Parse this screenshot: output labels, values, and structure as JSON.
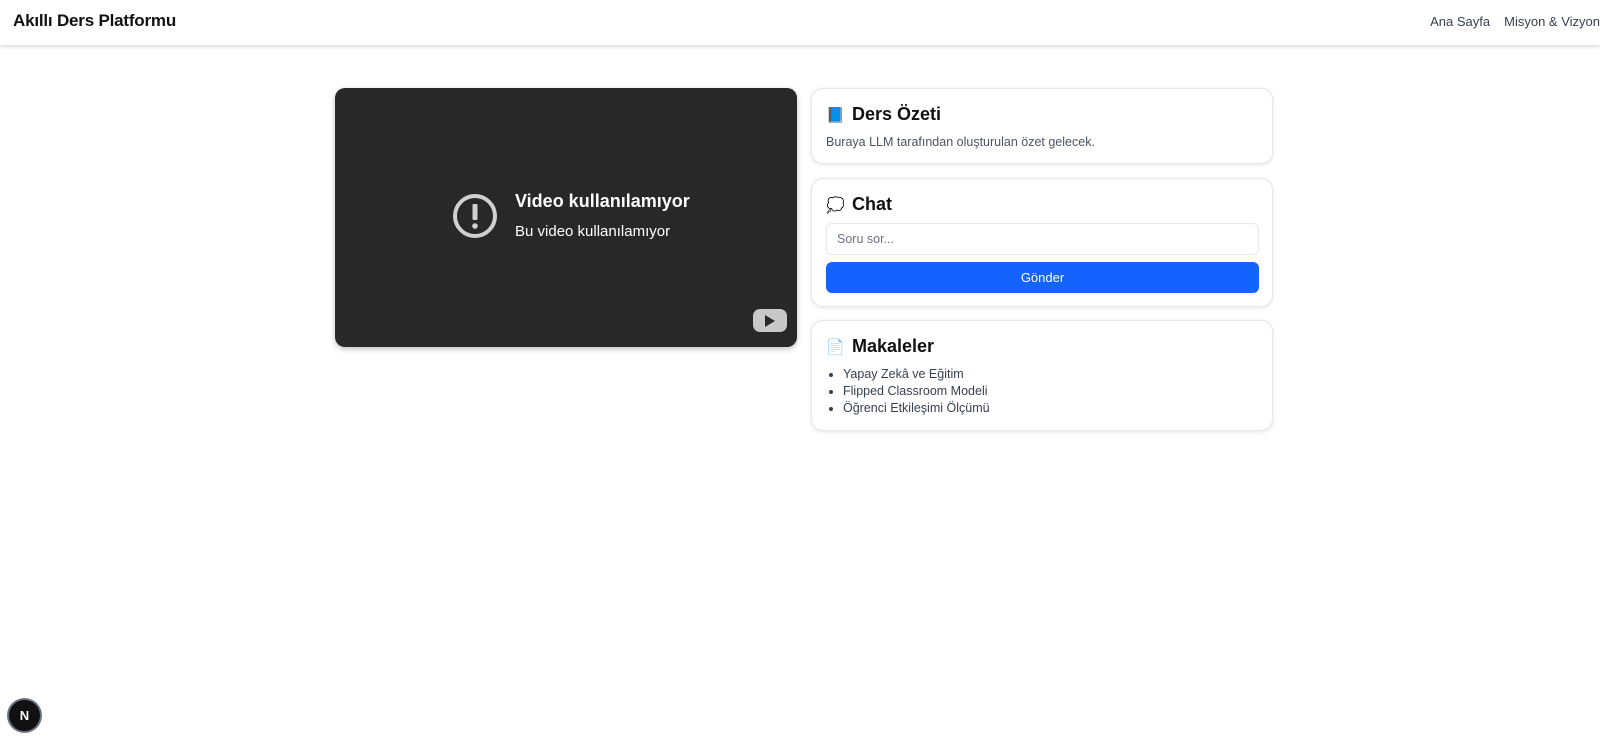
{
  "header": {
    "brand": "Akıllı Ders Platformu",
    "nav": [
      "Ana Sayfa",
      "Misyon & Vizyon"
    ]
  },
  "video": {
    "error_title": "Video kullanılamıyor",
    "error_subtitle": "Bu video kullanılamıyor",
    "icon": "alert-circle-icon",
    "logo_icon": "youtube-play-icon"
  },
  "summary": {
    "emoji": "📘",
    "title": "Ders Özeti",
    "text": "Buraya LLM tarafından oluşturulan özet gelecek."
  },
  "chat": {
    "emoji": "💭",
    "title": "Chat",
    "input_placeholder": "Soru sor...",
    "input_value": "",
    "send_label": "Gönder"
  },
  "articles": {
    "emoji": "📄",
    "title": "Makaleler",
    "items": [
      "Yapay Zekâ ve Eğitim",
      "Flipped Classroom Modeli",
      "Öğrenci Etkileşimi Ölçümü"
    ]
  },
  "dev_badge": {
    "label": "N"
  },
  "colors": {
    "accent": "#1463ff",
    "video_bg": "#282828"
  }
}
